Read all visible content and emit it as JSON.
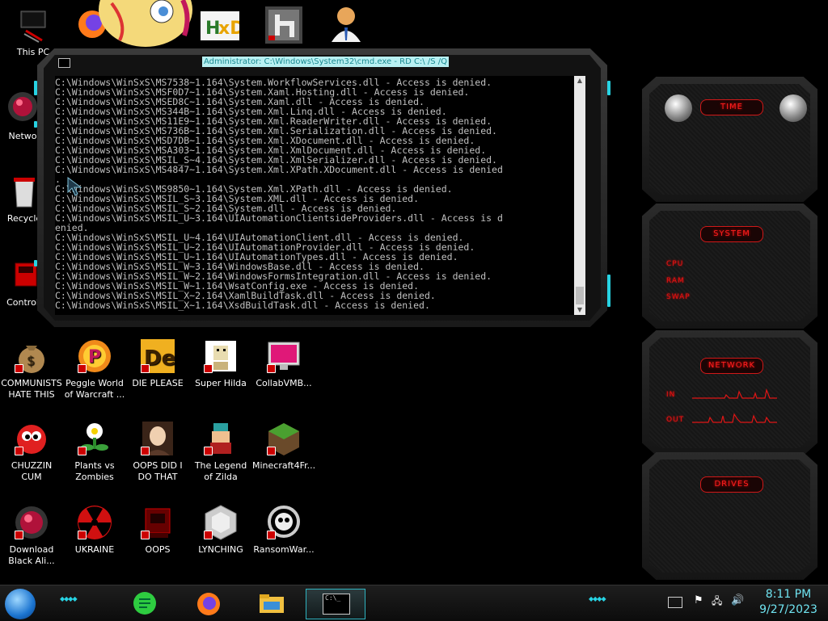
{
  "desktop": {
    "icons": [
      {
        "id": "this-pc",
        "label": "This PC",
        "icon": "computer-icon"
      },
      {
        "id": "network",
        "label": "Netwo",
        "icon": "network-icon"
      },
      {
        "id": "recycle",
        "label": "Recycle",
        "icon": "recycle-bin-icon"
      },
      {
        "id": "control",
        "label": "Control",
        "icon": "control-panel-icon"
      },
      {
        "id": "communists",
        "label": "COMMUNISTS HATE THIS G...",
        "icon": "money-bag-icon"
      },
      {
        "id": "peggle",
        "label": "Peggle World of Warcraft ...",
        "icon": "peggle-icon"
      },
      {
        "id": "die-please",
        "label": "DIE PLEASE",
        "icon": "de-icon"
      },
      {
        "id": "super-hilda",
        "label": "Super Hilda",
        "icon": "hilda-icon"
      },
      {
        "id": "collabvm",
        "label": "CollabVMB...",
        "icon": "monitor-icon"
      },
      {
        "id": "chuzzin",
        "label": "CHUZZIN CUM",
        "icon": "chuzzle-icon"
      },
      {
        "id": "pvz",
        "label": "Plants vs Zombies",
        "icon": "plants-icon"
      },
      {
        "id": "oops-did",
        "label": "OOPS DID I DO THAT",
        "icon": "portrait-icon"
      },
      {
        "id": "zilda",
        "label": "The Legend of Zilda",
        "icon": "zilda-icon"
      },
      {
        "id": "minecraft",
        "label": "Minecraft4Fr...",
        "icon": "grass-block-icon"
      },
      {
        "id": "download-black",
        "label": "Download Black Ali...",
        "icon": "alien-orb-icon"
      },
      {
        "id": "ukraine",
        "label": "UKRAINE",
        "icon": "radiation-icon"
      },
      {
        "id": "oops",
        "label": "OOPS",
        "icon": "red-box-icon"
      },
      {
        "id": "lynching",
        "label": "LYNCHING",
        "icon": "hex-icon"
      },
      {
        "id": "ransomware",
        "label": "RansomWar...",
        "icon": "skull-icon"
      }
    ]
  },
  "cmd": {
    "title": "Administrator: C:\\Windows\\System32\\cmd.exe - RD  C:\\ /S /Q",
    "lines": [
      "C:\\Windows\\WinSxS\\MS7538~1.164\\System.WorkflowServices.dll - Access is denied.",
      "C:\\Windows\\WinSxS\\MSF0D7~1.164\\System.Xaml.Hosting.dll - Access is denied.",
      "C:\\Windows\\WinSxS\\MSED8C~1.164\\System.Xaml.dll - Access is denied.",
      "C:\\Windows\\WinSxS\\MS344B~1.164\\System.Xml.Linq.dll - Access is denied.",
      "C:\\Windows\\WinSxS\\MS11E9~1.164\\System.Xml.ReaderWriter.dll - Access is denied.",
      "C:\\Windows\\WinSxS\\MS736B~1.164\\System.Xml.Serialization.dll - Access is denied.",
      "C:\\Windows\\WinSxS\\MSD7DB~1.164\\System.Xml.XDocument.dll - Access is denied.",
      "C:\\Windows\\WinSxS\\MSA303~1.164\\System.Xml.XmlDocument.dll - Access is denied.",
      "C:\\Windows\\WinSxS\\MSIL_S~4.164\\System.Xml.XmlSerializer.dll - Access is denied.",
      "C:\\Windows\\WinSxS\\MS4847~1.164\\System.Xml.XPath.XDocument.dll - Access is denied",
      ".",
      "C:\\Windows\\WinSxS\\MS9850~1.164\\System.Xml.XPath.dll - Access is denied.",
      "C:\\Windows\\WinSxS\\MSIL_S~3.164\\System.XML.dll - Access is denied.",
      "C:\\Windows\\WinSxS\\MSIL_S~2.164\\System.dll - Access is denied.",
      "C:\\Windows\\WinSxS\\MSIL_U~3.164\\UIAutomationClientsideProviders.dll - Access is d",
      "enied.",
      "C:\\Windows\\WinSxS\\MSIL_U~4.164\\UIAutomationClient.dll - Access is denied.",
      "C:\\Windows\\WinSxS\\MSIL_U~2.164\\UIAutomationProvider.dll - Access is denied.",
      "C:\\Windows\\WinSxS\\MSIL_U~1.164\\UIAutomationTypes.dll - Access is denied.",
      "C:\\Windows\\WinSxS\\MSIL_W~3.164\\WindowsBase.dll - Access is denied.",
      "C:\\Windows\\WinSxS\\MSIL_W~2.164\\WindowsFormsIntegration.dll - Access is denied.",
      "C:\\Windows\\WinSxS\\MSIL_W~1.164\\WsatConfig.exe - Access is denied.",
      "C:\\Windows\\WinSxS\\MSIL_X~2.164\\XamlBuildTask.dll - Access is denied.",
      "C:\\Windows\\WinSxS\\MSIL_X~1.164\\XsdBuildTask.dll - Access is denied."
    ]
  },
  "gadgets": {
    "time": {
      "title": "TIME"
    },
    "system": {
      "title": "SYSTEM",
      "cpu": "CPU",
      "ram": "RAM",
      "swap": "SWAP"
    },
    "network": {
      "title": "NETWORK",
      "in": "IN",
      "out": "OUT"
    },
    "drives": {
      "title": "DRIVES"
    }
  },
  "taskbar": {
    "clock_time": "8:11 PM",
    "clock_date": "9/27/2023",
    "apps": [
      "start-orb",
      "notes-app-icon",
      "firefox-icon",
      "file-explorer-icon",
      "cmd-icon"
    ]
  },
  "colors": {
    "accent_cyan": "#27d3e3",
    "accent_red": "#e01515",
    "console_text": "#c0c0c0",
    "title_bg": "#b8f0f2"
  }
}
